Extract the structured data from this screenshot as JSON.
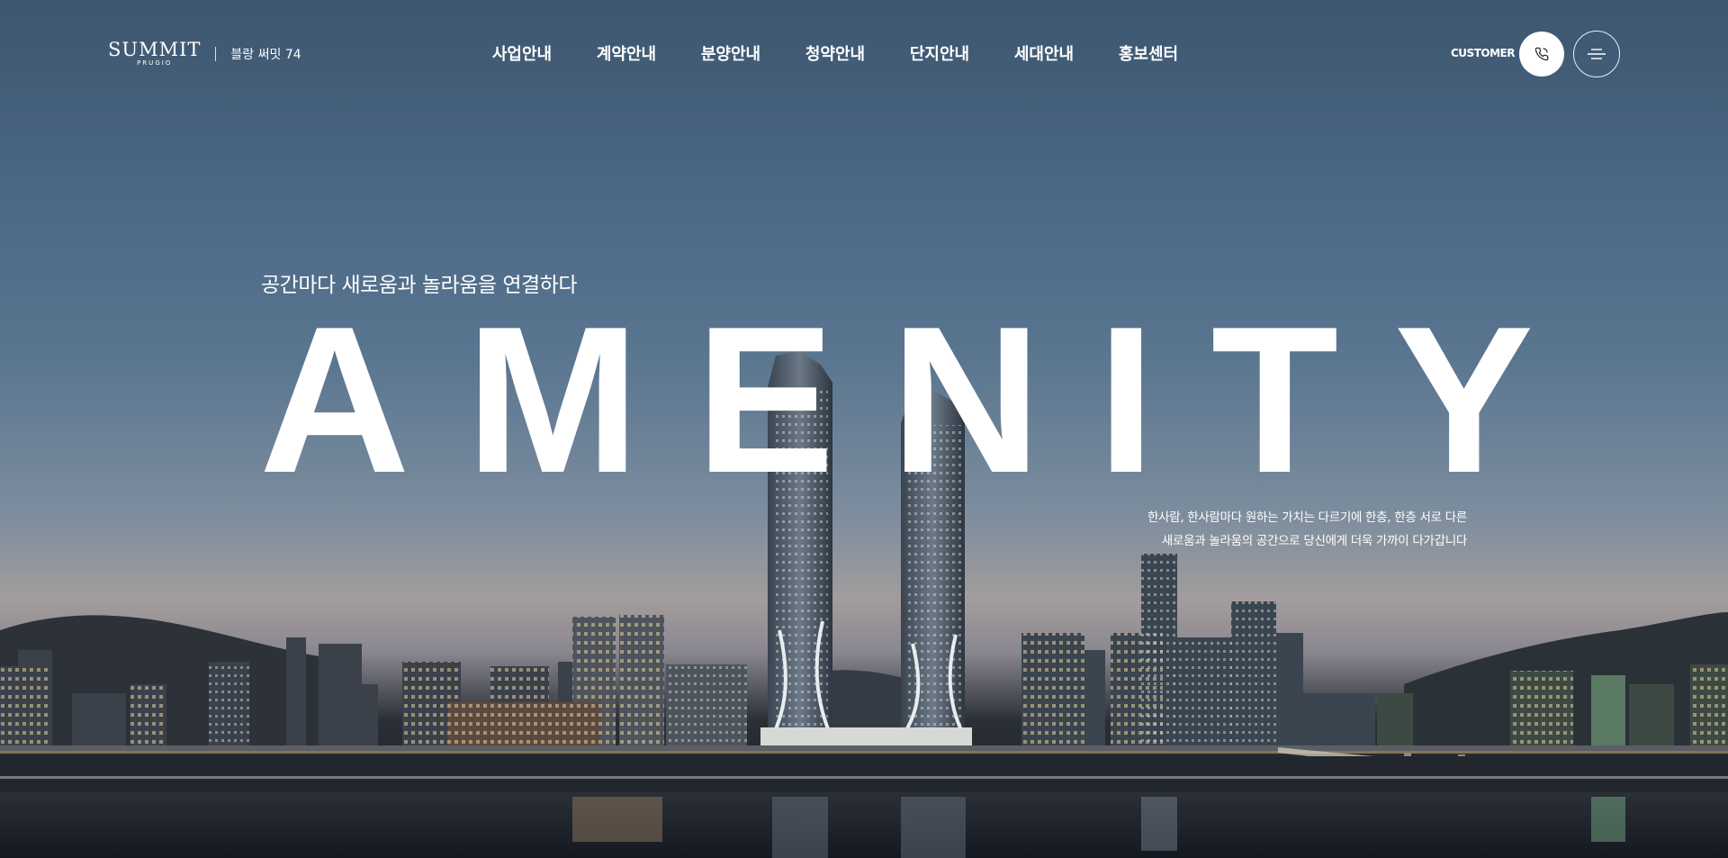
{
  "header": {
    "logo": {
      "main": "SUMMIT",
      "sub": "PRUGIO",
      "site_name": "블랑 써밋 74"
    },
    "nav": [
      {
        "label": "사업안내"
      },
      {
        "label": "계약안내"
      },
      {
        "label": "분양안내"
      },
      {
        "label": "청약안내"
      },
      {
        "label": "단지안내"
      },
      {
        "label": "세대안내"
      },
      {
        "label": "홍보센터"
      }
    ],
    "customer_label": "CUSTOMER",
    "icons": {
      "phone": "phone-icon",
      "menu": "menu-icon"
    }
  },
  "hero": {
    "tagline": "공간마다 새로움과 놀라움을 연결하다",
    "headline": "AMENITY",
    "description": [
      "한사람, 한사람마다 원하는 가치는 다르기에 한층, 한층 서로 다른",
      "새로움과 놀라움의 공간으로 당신에게 더욱 가까이 다가갑니다"
    ]
  },
  "colors": {
    "sky_top": "#3e566f",
    "sky_mid": "#5a7690",
    "horizon": "#a39c9c",
    "water": "#1a1e24",
    "text": "#ffffff"
  }
}
